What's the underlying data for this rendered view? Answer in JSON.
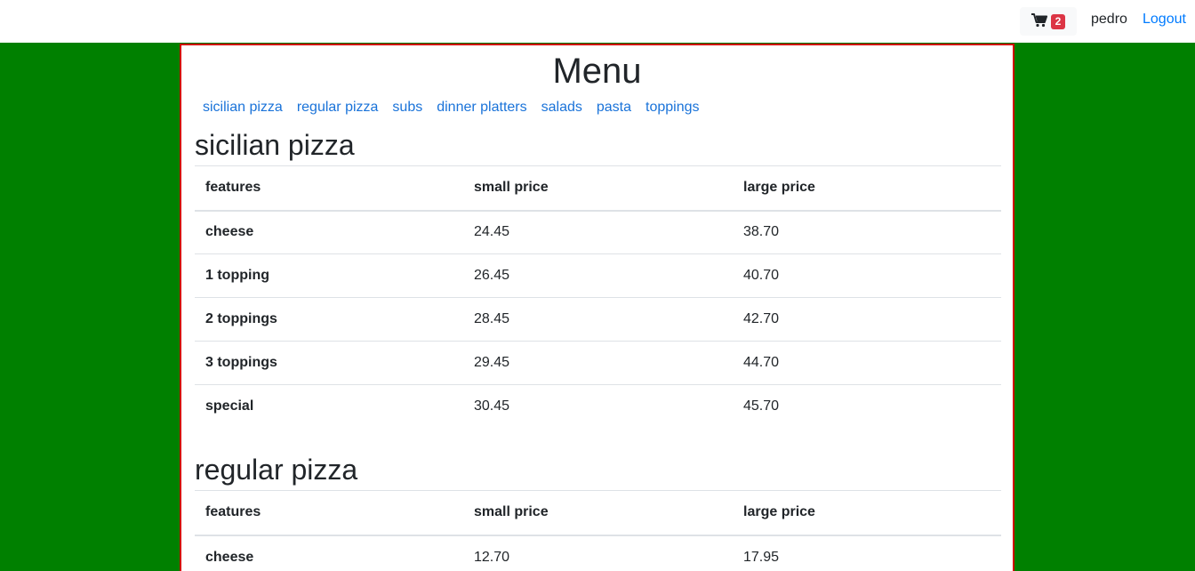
{
  "navbar": {
    "cart_count": "2",
    "username": "pedro",
    "logout_label": "Logout"
  },
  "page": {
    "title": "Menu"
  },
  "categories": [
    "sicilian pizza",
    "regular pizza",
    "subs",
    "dinner platters",
    "salads",
    "pasta",
    "toppings"
  ],
  "sections": [
    {
      "title": "sicilian pizza",
      "headers": [
        "features",
        "small price",
        "large price"
      ],
      "rows": [
        [
          "cheese",
          "24.45",
          "38.70"
        ],
        [
          "1 topping",
          "26.45",
          "40.70"
        ],
        [
          "2 toppings",
          "28.45",
          "42.70"
        ],
        [
          "3 toppings",
          "29.45",
          "44.70"
        ],
        [
          "special",
          "30.45",
          "45.70"
        ]
      ]
    },
    {
      "title": "regular pizza",
      "headers": [
        "features",
        "small price",
        "large price"
      ],
      "rows": [
        [
          "cheese",
          "12.70",
          "17.95"
        ]
      ]
    }
  ],
  "colors": {
    "background": "#008000",
    "container_border": "#d00000",
    "link": "#007bff",
    "badge": "#dc3545"
  }
}
